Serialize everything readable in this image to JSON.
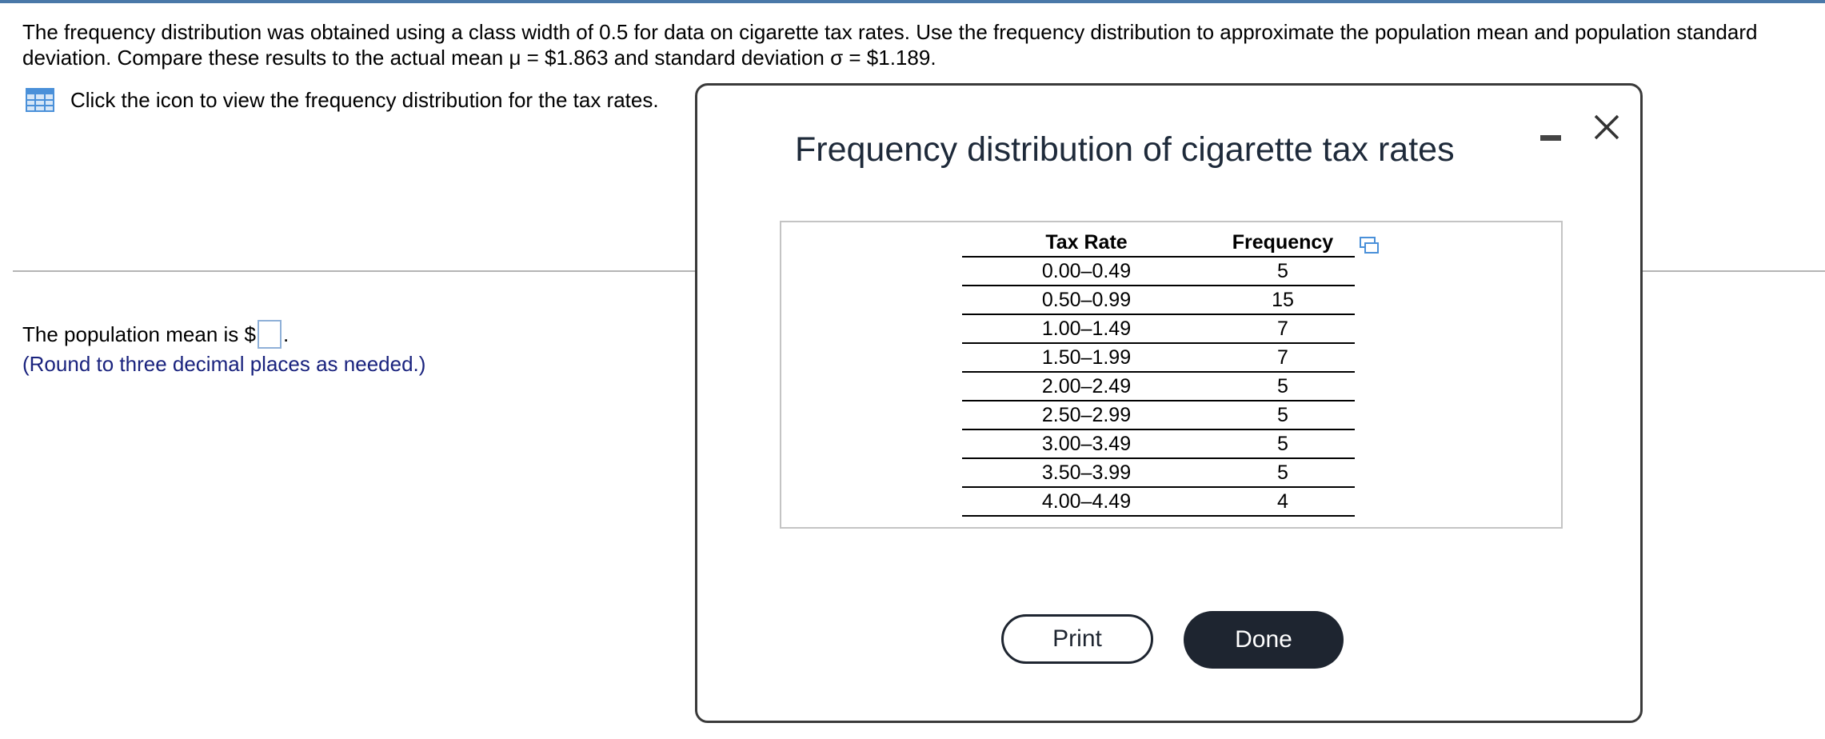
{
  "question": {
    "text": "The frequency distribution was obtained using a class width of 0.5 for data on cigarette tax rates. Use the frequency distribution to approximate the population mean and population standard deviation. Compare these results to the actual mean μ = $1.863 and standard deviation σ = $1.189."
  },
  "icon_link": {
    "icon": "table-icon",
    "text": "Click the icon to view the frequency distribution for the tax rates."
  },
  "answer": {
    "prefix": "The population mean is $",
    "suffix": ".",
    "value": "",
    "hint": "(Round to three decimal places as needed.)"
  },
  "dialog": {
    "title": "Frequency distribution of cigarette tax rates",
    "table": {
      "headers": [
        "Tax Rate",
        "Frequency"
      ],
      "rows": [
        [
          "0.00–0.49",
          "5"
        ],
        [
          "0.50–0.99",
          "15"
        ],
        [
          "1.00–1.49",
          "7"
        ],
        [
          "1.50–1.99",
          "7"
        ],
        [
          "2.00–2.49",
          "5"
        ],
        [
          "2.50–2.99",
          "5"
        ],
        [
          "3.00–3.49",
          "5"
        ],
        [
          "3.50–3.99",
          "5"
        ],
        [
          "4.00–4.49",
          "4"
        ]
      ]
    },
    "print_label": "Print",
    "done_label": "Done"
  },
  "colors": {
    "accent_bar": "#4a78a8",
    "hint_text": "#1a237e",
    "done_button": "#1e2530",
    "table_icon": "#4a90d9"
  }
}
